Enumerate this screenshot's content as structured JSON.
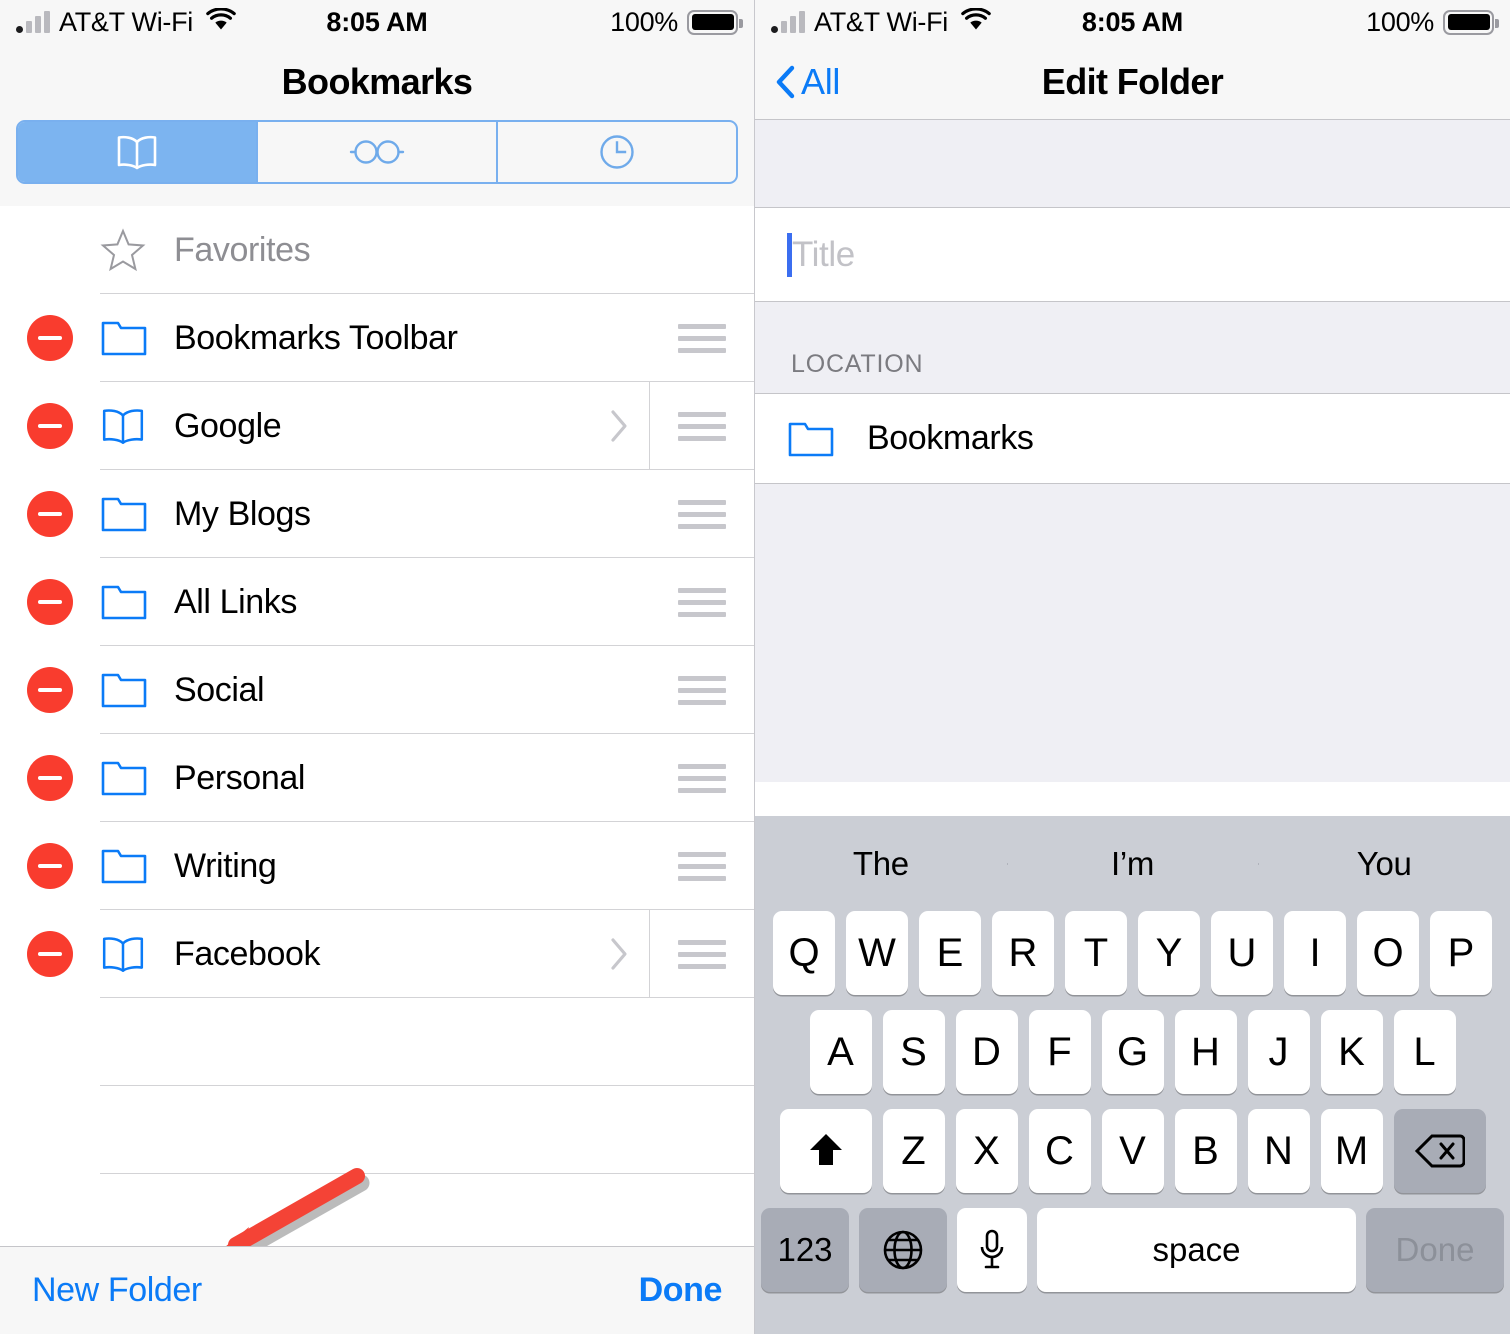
{
  "status_bar": {
    "carrier": "AT&T Wi-Fi",
    "time": "8:05 AM",
    "battery_percent": "100%",
    "wifi_icon": "wifi-icon",
    "signal_icon": "signal-bars-icon",
    "battery_icon": "battery-full-icon"
  },
  "left_screen": {
    "nav": {
      "title": "Bookmarks"
    },
    "segmented_control": {
      "selected_index": 0,
      "segments": [
        {
          "icon": "book-icon",
          "name": "bookmarks-tab"
        },
        {
          "icon": "reading-glasses-icon",
          "name": "reading-list-tab"
        },
        {
          "icon": "clock-icon",
          "name": "history-tab"
        }
      ]
    },
    "list": [
      {
        "label": "Favorites",
        "icon": "star-icon",
        "deletable": false,
        "reorderable": false,
        "chevron": false,
        "muted": true
      },
      {
        "label": "Bookmarks Toolbar",
        "icon": "folder-icon",
        "deletable": true,
        "reorderable": true,
        "chevron": false,
        "muted": false
      },
      {
        "label": "Google",
        "icon": "book-icon",
        "deletable": true,
        "reorderable": true,
        "chevron": true,
        "muted": false
      },
      {
        "label": "My Blogs",
        "icon": "folder-icon",
        "deletable": true,
        "reorderable": true,
        "chevron": false,
        "muted": false
      },
      {
        "label": "All Links",
        "icon": "folder-icon",
        "deletable": true,
        "reorderable": true,
        "chevron": false,
        "muted": false
      },
      {
        "label": "Social",
        "icon": "folder-icon",
        "deletable": true,
        "reorderable": true,
        "chevron": false,
        "muted": false
      },
      {
        "label": "Personal",
        "icon": "folder-icon",
        "deletable": true,
        "reorderable": true,
        "chevron": false,
        "muted": false
      },
      {
        "label": "Writing",
        "icon": "folder-icon",
        "deletable": true,
        "reorderable": true,
        "chevron": false,
        "muted": false
      },
      {
        "label": "Facebook",
        "icon": "book-icon",
        "deletable": true,
        "reorderable": true,
        "chevron": true,
        "muted": false
      }
    ],
    "toolbar": {
      "new_folder_label": "New Folder",
      "done_label": "Done"
    },
    "annotation": {
      "type": "arrow",
      "color": "#f44336",
      "points_to": "New Folder"
    }
  },
  "right_screen": {
    "nav": {
      "back_label": "All",
      "title": "Edit Folder",
      "back_icon": "chevron-left-icon"
    },
    "title_field": {
      "value": "",
      "placeholder": "Title",
      "focused": true
    },
    "location_section": {
      "header": "LOCATION",
      "item": {
        "label": "Bookmarks",
        "icon": "folder-icon"
      }
    },
    "keyboard": {
      "predictions": [
        "The",
        "I’m",
        "You"
      ],
      "row1": [
        "Q",
        "W",
        "E",
        "R",
        "T",
        "Y",
        "U",
        "I",
        "O",
        "P"
      ],
      "row2": [
        "A",
        "S",
        "D",
        "F",
        "G",
        "H",
        "J",
        "K",
        "L"
      ],
      "row3_letters": [
        "Z",
        "X",
        "C",
        "V",
        "B",
        "N",
        "M"
      ],
      "shift_icon": "shift-up-arrow-icon",
      "backspace_icon": "backspace-delete-icon",
      "numbers_label": "123",
      "globe_icon": "globe-language-icon",
      "mic_icon": "microphone-icon",
      "space_label": "space",
      "return_label": "Done",
      "return_enabled": false
    }
  },
  "colors": {
    "accent_blue": "#0b7bf7",
    "segment_blue": "#7cb4f0",
    "segment_border": "#79b0ef",
    "delete_red": "#f93c2e",
    "annotation_red": "#f44336",
    "group_background": "#efeff4",
    "keyboard_background": "#cbced5"
  }
}
